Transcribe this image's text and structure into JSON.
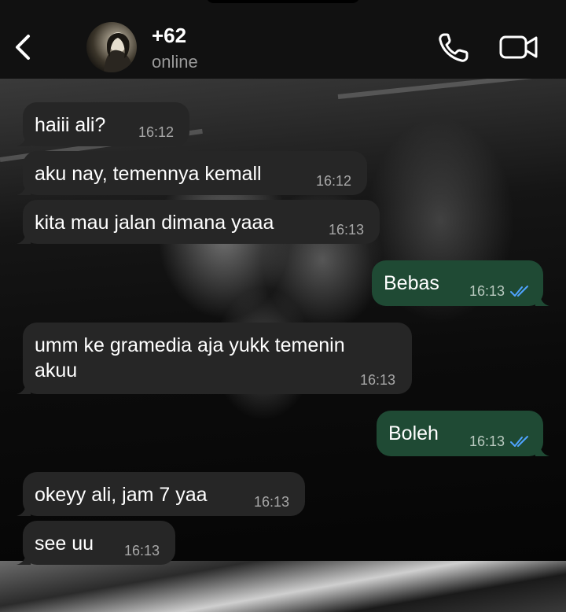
{
  "header": {
    "back_icon": "chevron-left-icon",
    "contact_name": "+62",
    "contact_status": "online",
    "call_icon": "phone-icon",
    "video_icon": "video-camera-icon"
  },
  "messages": [
    {
      "direction": "in",
      "text": "haiii ali?",
      "time": "16:12"
    },
    {
      "direction": "in",
      "text": "aku nay, temennya kemall",
      "time": "16:12"
    },
    {
      "direction": "in",
      "text": "kita mau jalan dimana yaaa",
      "time": "16:13"
    },
    {
      "direction": "out",
      "text": "Bebas",
      "time": "16:13",
      "read": true
    },
    {
      "direction": "in",
      "text_line1": "umm ke gramedia aja yukk temenin",
      "text_line2": "akuu",
      "time": "16:13"
    },
    {
      "direction": "out",
      "text": "Boleh",
      "time": "16:13",
      "read": true
    },
    {
      "direction": "in",
      "text": "okeyy ali, jam 7 yaa",
      "time": "16:13"
    },
    {
      "direction": "in",
      "text": "see uu",
      "time": "16:13"
    }
  ],
  "colors": {
    "incoming_bubble": "#262626",
    "outgoing_bubble": "#1f4a34",
    "read_ticks": "#4fa3ff",
    "header_bg": "#111111"
  }
}
